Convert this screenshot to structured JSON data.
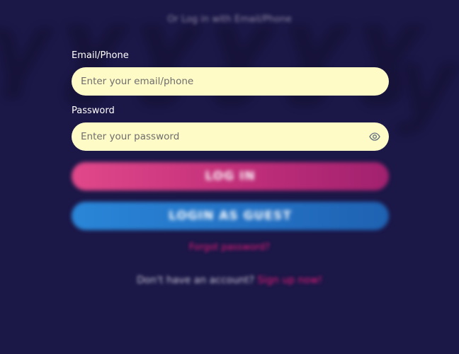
{
  "subtitle": "Or Log in with Email/Phone",
  "email": {
    "label": "Email/Phone",
    "placeholder": "Enter your email/phone",
    "value": ""
  },
  "password": {
    "label": "Password",
    "placeholder": "Enter your password",
    "value": "",
    "toggle_icon": "eye-icon"
  },
  "buttons": {
    "login": "LOG IN",
    "guest": "LOGIN AS GUEST"
  },
  "forgot_password": "Forgot password?",
  "signup": {
    "prompt": "Don't have an account?",
    "link": "Sign up now!"
  },
  "colors": {
    "background": "#1b1747",
    "input_bg": "#fffbc6",
    "login_gradient_start": "#e1488a",
    "login_gradient_end": "#a1216f",
    "guest_gradient_start": "#2a86d8",
    "guest_gradient_end": "#1f62b2",
    "link": "#e81a78"
  }
}
